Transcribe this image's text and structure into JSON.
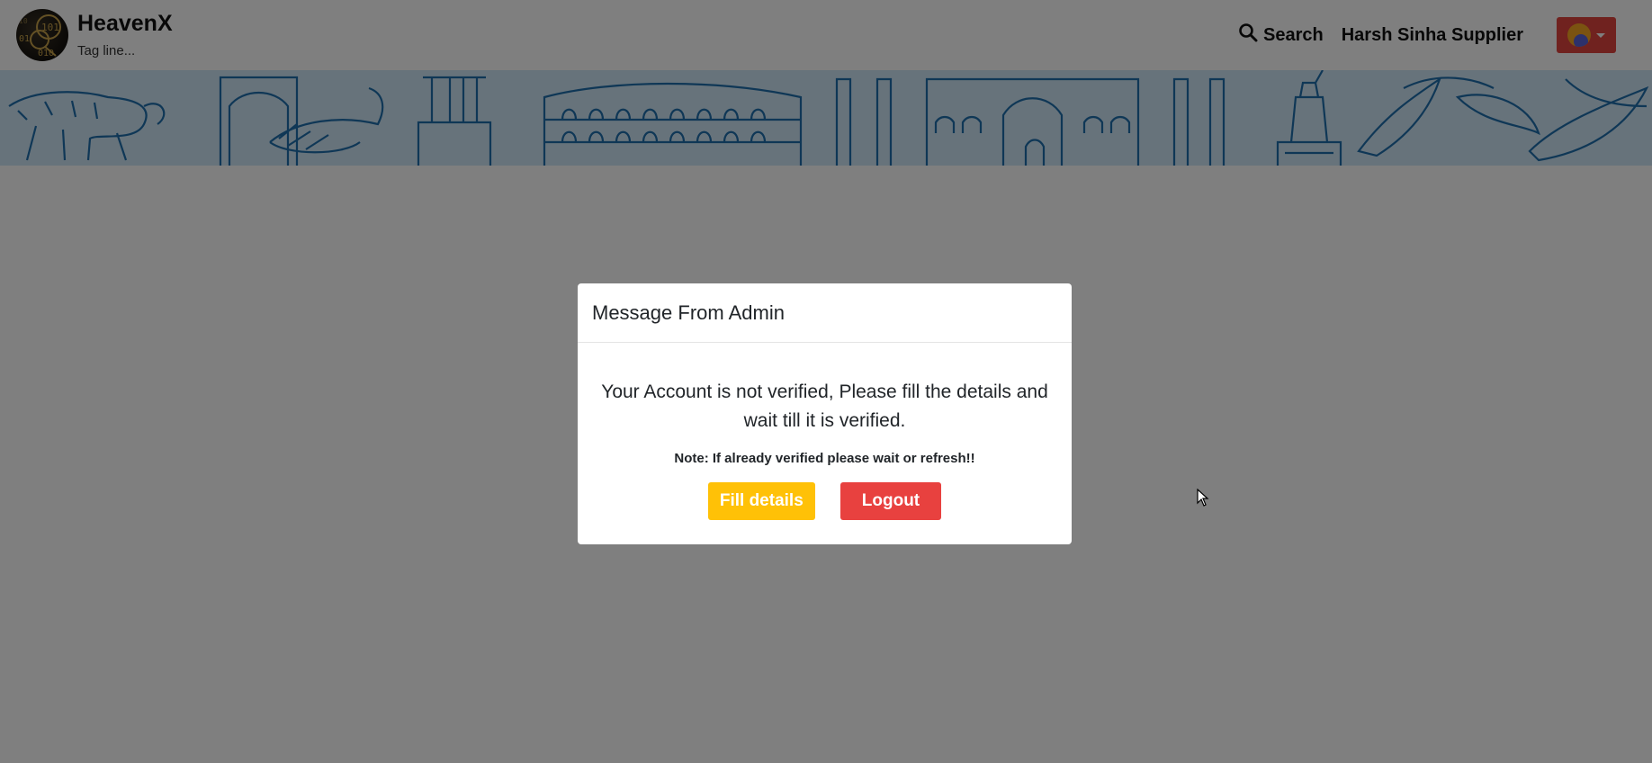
{
  "navbar": {
    "brand_name": "HeavenX",
    "tagline": "Tag line...",
    "search_label": "Search",
    "user_name": "Harsh Sinha Supplier"
  },
  "modal": {
    "title": "Message From Admin",
    "message": "Your Account is not verified, Please fill the details and wait till it is verified.",
    "note": "Note: If already verified please wait or refresh!!",
    "fill_details_label": "Fill details",
    "logout_label": "Logout"
  },
  "icons": {
    "search": "search-icon",
    "avatar": "avatar",
    "dropdown": "chevron-down-icon",
    "cursor": "mouse-cursor-icon"
  },
  "colors": {
    "fill_details_button": "#ffc107",
    "logout_button": "#e8413f",
    "user_menu": "#e0443f",
    "banner": "#cfe6f7",
    "banner_ink": "#1f6fad"
  }
}
